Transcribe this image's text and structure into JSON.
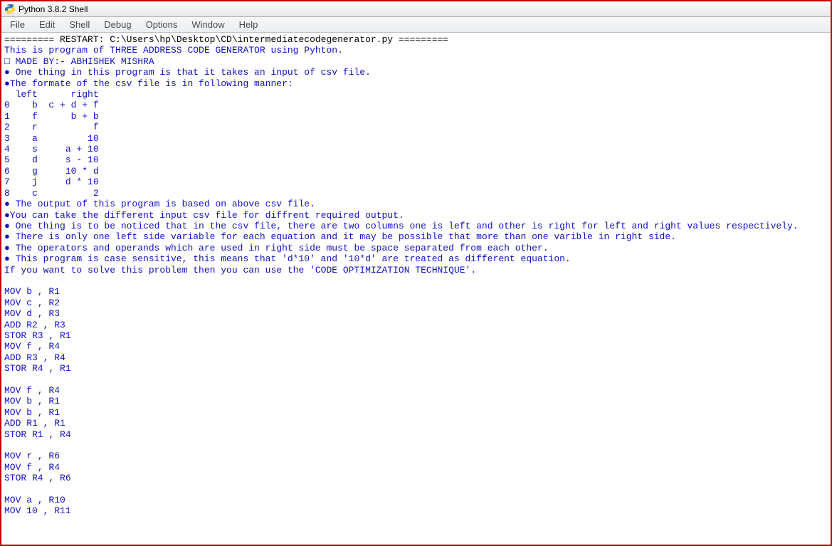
{
  "window": {
    "title": "Python 3.8.2 Shell"
  },
  "menu": {
    "items": [
      "File",
      "Edit",
      "Shell",
      "Debug",
      "Options",
      "Window",
      "Help"
    ]
  },
  "lines": [
    {
      "cls": "black",
      "text": "========= RESTART: C:\\Users\\hp\\Desktop\\CD\\intermediatecodegenerator.py ========="
    },
    {
      "cls": "blue",
      "text": "This is program of THREE ADDRESS CODE GENERATOR using Pyhton."
    },
    {
      "cls": "blue",
      "text": "□ MADE BY:- ABHISHEK MISHRA"
    },
    {
      "cls": "blue",
      "text": "● One thing in this program is that it takes an input of csv file."
    },
    {
      "cls": "blue",
      "text": "●The formate of the csv file is in following manner:"
    },
    {
      "cls": "blue",
      "text": "  left      right"
    },
    {
      "cls": "blue",
      "text": "0    b  c + d + f"
    },
    {
      "cls": "blue",
      "text": "1    f      b + b"
    },
    {
      "cls": "blue",
      "text": "2    r          f"
    },
    {
      "cls": "blue",
      "text": "3    a         10"
    },
    {
      "cls": "blue",
      "text": "4    s     a + 10"
    },
    {
      "cls": "blue",
      "text": "5    d     s - 10"
    },
    {
      "cls": "blue",
      "text": "6    g     10 * d"
    },
    {
      "cls": "blue",
      "text": "7    j     d * 10"
    },
    {
      "cls": "blue",
      "text": "8    c          2"
    },
    {
      "cls": "blue",
      "text": "● The output of this program is based on above csv file."
    },
    {
      "cls": "blue",
      "text": "●You can take the different input csv file for diffrent required output."
    },
    {
      "cls": "blue",
      "text": "● One thing is to be noticed that in the csv file, there are two columns one is left and other is right for left and right values respectively."
    },
    {
      "cls": "blue",
      "text": "● There is only one left side variable for each equation and it may be possible that more than one varible in right side."
    },
    {
      "cls": "blue",
      "text": "● The operators and operands which are used in right side must be space separated from each other."
    },
    {
      "cls": "blue",
      "text": "● This program is case sensitive, this means that 'd*10' and '10*d' are treated as different equation."
    },
    {
      "cls": "blue",
      "text": "If you want to solve this problem then you can use the 'CODE OPTIMIZATION TECHNIQUE'."
    },
    {
      "cls": "blue",
      "text": ""
    },
    {
      "cls": "blue",
      "text": "MOV b , R1"
    },
    {
      "cls": "blue",
      "text": "MOV c , R2"
    },
    {
      "cls": "blue",
      "text": "MOV d , R3"
    },
    {
      "cls": "blue",
      "text": "ADD R2 , R3"
    },
    {
      "cls": "blue",
      "text": "STOR R3 , R1"
    },
    {
      "cls": "blue",
      "text": "MOV f , R4"
    },
    {
      "cls": "blue",
      "text": "ADD R3 , R4"
    },
    {
      "cls": "blue",
      "text": "STOR R4 , R1"
    },
    {
      "cls": "blue",
      "text": ""
    },
    {
      "cls": "blue",
      "text": "MOV f , R4"
    },
    {
      "cls": "blue",
      "text": "MOV b , R1"
    },
    {
      "cls": "blue",
      "text": "MOV b , R1"
    },
    {
      "cls": "blue",
      "text": "ADD R1 , R1"
    },
    {
      "cls": "blue",
      "text": "STOR R1 , R4"
    },
    {
      "cls": "blue",
      "text": ""
    },
    {
      "cls": "blue",
      "text": "MOV r , R6"
    },
    {
      "cls": "blue",
      "text": "MOV f , R4"
    },
    {
      "cls": "blue",
      "text": "STOR R4 , R6"
    },
    {
      "cls": "blue",
      "text": ""
    },
    {
      "cls": "blue",
      "text": "MOV a , R10"
    },
    {
      "cls": "blue",
      "text": "MOV 10 , R11"
    }
  ]
}
